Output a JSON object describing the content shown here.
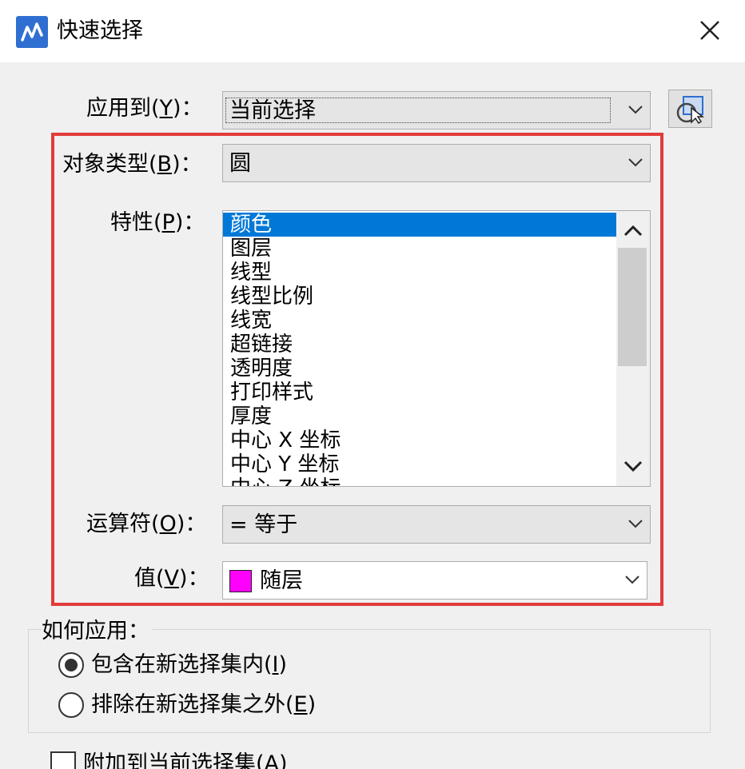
{
  "window": {
    "title": "快速选择"
  },
  "apply_to": {
    "label_prefix": "应用到(",
    "label_key": "Y",
    "label_suffix": ")：",
    "value": "当前选择"
  },
  "object_type": {
    "label_prefix": "对象类型(",
    "label_key": "B",
    "label_suffix": ")：",
    "value": "圆"
  },
  "properties": {
    "label_prefix": "特性(",
    "label_key": "P",
    "label_suffix": ")：",
    "items": [
      "颜色",
      "图层",
      "线型",
      "线型比例",
      "线宽",
      "超链接",
      "透明度",
      "打印样式",
      "厚度",
      "中心 X 坐标",
      "中心 Y 坐标",
      "中心 Z 坐标"
    ],
    "selected_index": 0
  },
  "operator": {
    "label_prefix": "运算符(",
    "label_key": "O",
    "label_suffix": ")：",
    "value": "= 等于"
  },
  "value_field": {
    "label_prefix": "值(",
    "label_key": "V",
    "label_suffix": ")：",
    "value": "随层",
    "swatch_color": "#ff00ff"
  },
  "how_to_apply": {
    "title": "如何应用：",
    "options": [
      {
        "text_prefix": "包含在新选择集内(",
        "key": "I",
        "text_suffix": ")",
        "checked": true
      },
      {
        "text_prefix": "排除在新选择集之外(",
        "key": "E",
        "text_suffix": ")",
        "checked": false
      }
    ]
  },
  "append": {
    "text_prefix": "附加到当前选择集(",
    "key": "A",
    "text_suffix": ")",
    "checked": false
  },
  "colors": {
    "highlight_frame": "#e23b3b",
    "selection": "#0078d7",
    "app_icon": "#2f6fd1"
  }
}
